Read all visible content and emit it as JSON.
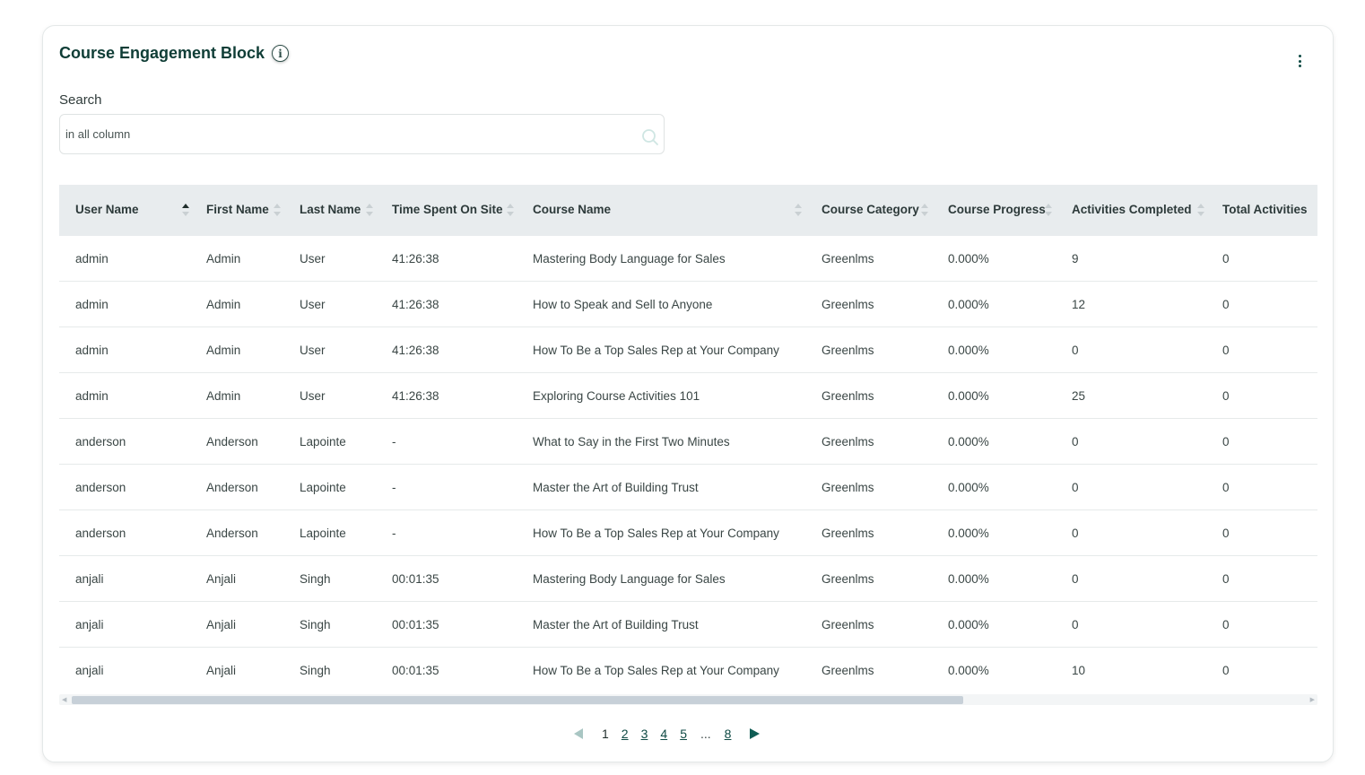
{
  "card": {
    "title": "Course Engagement Block",
    "info_icon": "i",
    "menu_icon": "kebab-icon"
  },
  "search": {
    "label": "Search",
    "placeholder": "in all column",
    "icon": "search-icon"
  },
  "table": {
    "columns": [
      {
        "label": "User Name",
        "sort": "asc"
      },
      {
        "label": "First Name",
        "sort": "none"
      },
      {
        "label": "Last Name",
        "sort": "none"
      },
      {
        "label": "Time Spent On Site",
        "sort": "none"
      },
      {
        "label": "Course Name",
        "sort": "none"
      },
      {
        "label": "Course Category",
        "sort": "none"
      },
      {
        "label": "Course Progress",
        "sort": "none"
      },
      {
        "label": "Activities Completed",
        "sort": "none"
      },
      {
        "label": "Total Activities",
        "sort": "none"
      }
    ],
    "rows": [
      [
        "admin",
        "Admin",
        "User",
        "41:26:38",
        "Mastering Body Language for Sales",
        "Greenlms",
        "0.000%",
        "9",
        "0"
      ],
      [
        "admin",
        "Admin",
        "User",
        "41:26:38",
        "How to Speak and Sell to Anyone",
        "Greenlms",
        "0.000%",
        "12",
        "0"
      ],
      [
        "admin",
        "Admin",
        "User",
        "41:26:38",
        "How To Be a Top Sales Rep at Your Company",
        "Greenlms",
        "0.000%",
        "0",
        "0"
      ],
      [
        "admin",
        "Admin",
        "User",
        "41:26:38",
        "Exploring Course Activities 101",
        "Greenlms",
        "0.000%",
        "25",
        "0"
      ],
      [
        "anderson",
        "Anderson",
        "Lapointe",
        "-",
        "What to Say in the First Two Minutes",
        "Greenlms",
        "0.000%",
        "0",
        "0"
      ],
      [
        "anderson",
        "Anderson",
        "Lapointe",
        "-",
        "Master the Art of Building Trust",
        "Greenlms",
        "0.000%",
        "0",
        "0"
      ],
      [
        "anderson",
        "Anderson",
        "Lapointe",
        "-",
        "How To Be a Top Sales Rep at Your Company",
        "Greenlms",
        "0.000%",
        "0",
        "0"
      ],
      [
        "anjali",
        "Anjali",
        "Singh",
        "00:01:35",
        "Mastering Body Language for Sales",
        "Greenlms",
        "0.000%",
        "0",
        "0"
      ],
      [
        "anjali",
        "Anjali",
        "Singh",
        "00:01:35",
        "Master the Art of Building Trust",
        "Greenlms",
        "0.000%",
        "0",
        "0"
      ],
      [
        "anjali",
        "Anjali",
        "Singh",
        "00:01:35",
        "How To Be a Top Sales Rep at Your Company",
        "Greenlms",
        "0.000%",
        "10",
        "0"
      ]
    ]
  },
  "scrollbar": {
    "thumb_fraction": 0.73
  },
  "pagination": {
    "current": "1",
    "pages": [
      "1",
      "2",
      "3",
      "4",
      "5"
    ],
    "ellipsis": "...",
    "last": "8"
  }
}
